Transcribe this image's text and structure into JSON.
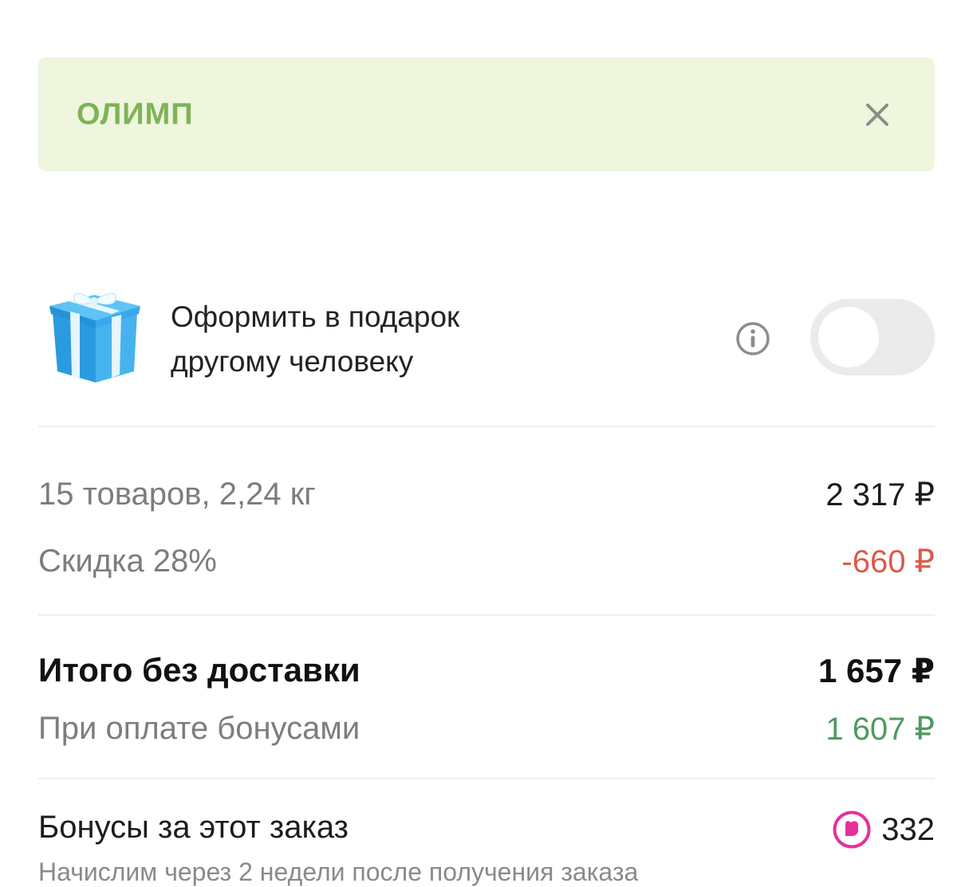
{
  "promo": {
    "code": "ОЛИМП"
  },
  "gift": {
    "line1": "Оформить в подарок",
    "line2": "другому человеку",
    "toggle_on": false
  },
  "summary": {
    "items_label": "15 товаров, 2,24 кг",
    "items_price": "2 317 ₽",
    "discount_label": "Скидка 28%",
    "discount_value": "-660 ₽",
    "total_label": "Итого без доставки",
    "total_value": "1 657 ₽",
    "bonus_pay_label": "При оплате бонусами",
    "bonus_pay_value": "1 607 ₽"
  },
  "bonuses": {
    "label": "Бонусы за этот заказ",
    "value": "332",
    "note": "Начислим через 2 недели после получения заказа"
  },
  "colors": {
    "promo_bg": "#eef6de",
    "promo_text": "#7fb356",
    "discount": "#dc5a4a",
    "bonus_price": "#4e9a5f",
    "bonus_icon": "#e5319a"
  },
  "icons": {
    "close": "close-icon",
    "gift": "gift-box-icon",
    "info": "info-icon",
    "bonus": "heart-bonus-icon"
  }
}
